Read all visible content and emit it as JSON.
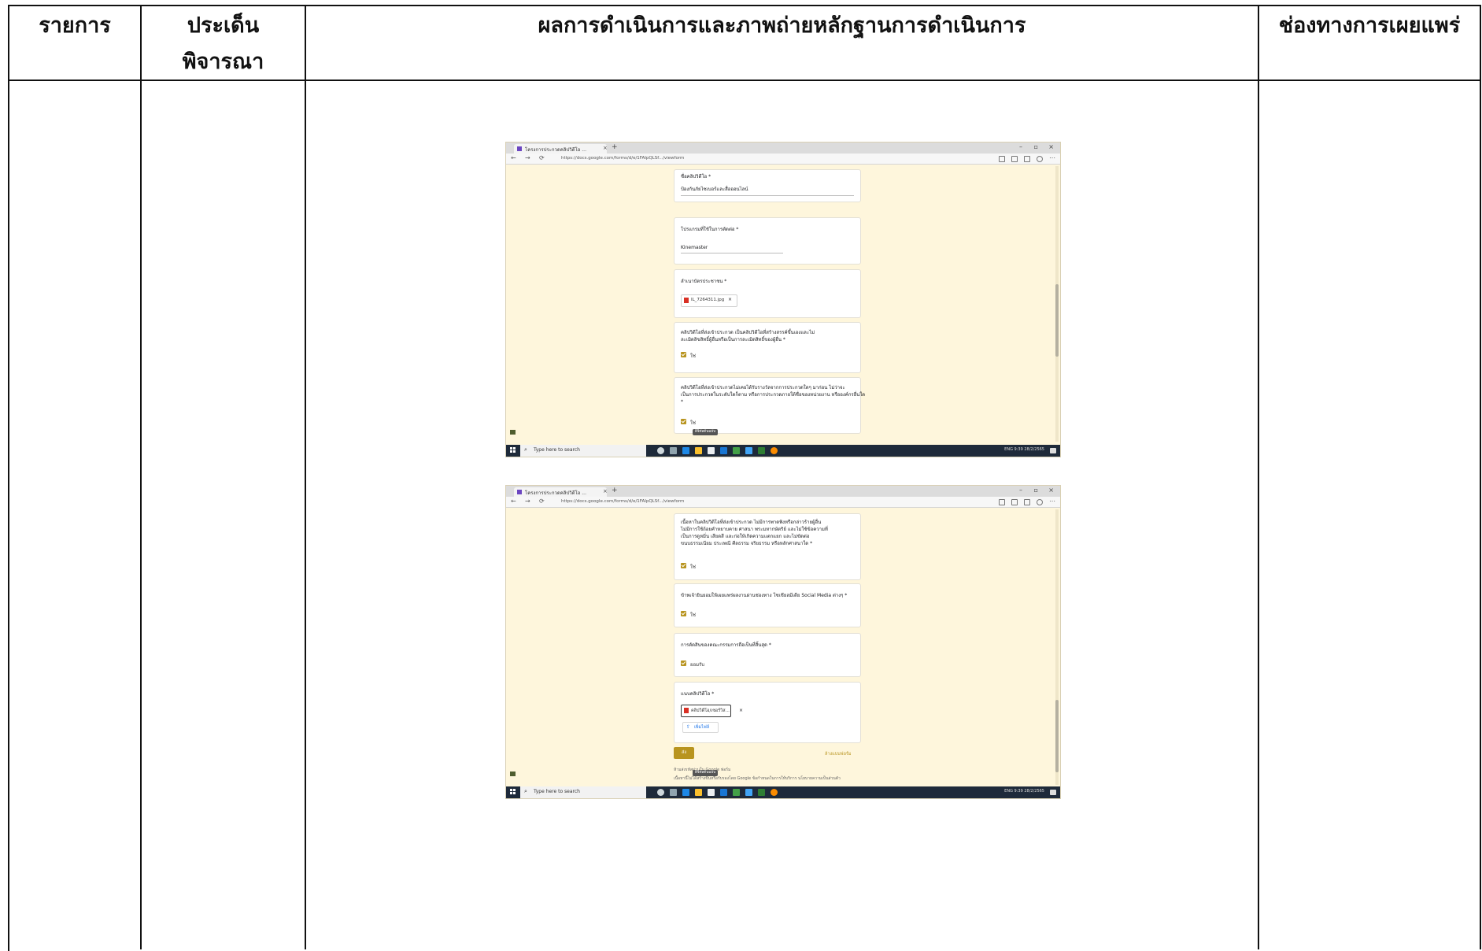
{
  "table": {
    "headers": {
      "col1": "รายการ",
      "col2_line1": "ประเด็น",
      "col2_line2": "พิจารณา",
      "col3": "ผลการดำเนินการและภาพถ่ายหลักฐานการดำเนินการ",
      "col4": "ช่องทางการเผยแพร่"
    }
  },
  "screenshot1": {
    "tab_title": "โครงการประกวดคลิปวิดีโอ ...",
    "url": "https://docs.google.com/forms/d/e/1FAIpQLSf.../viewform",
    "cards": [
      {
        "question": "ชื่อคลิปวิดีโอ *",
        "answer": "ป้องกันภัยไซเบอร์และสื่อออนไลน์"
      },
      {
        "question": "โปรแกรมที่ใช้ในการตัดต่อ *",
        "answer": "Kinemaster"
      },
      {
        "question": "ลำเนาบัตรประชาชน *",
        "file": "IL_7264311.jpg"
      },
      {
        "question_line1": "คลิปวิดีโอที่ส่งเข้าประกวด เป็นคลิปวิดีโอที่สร้างสรรค์ขึ้นเองและไม่",
        "question_line2": "ละเมิดลิขสิทธิ์ผู้อื่นหรือเป็นการละเมิดสิทธิ์ของผู้อื่น *",
        "check": "ใช่"
      },
      {
        "question_line1": "คลิปวิดีโอที่ส่งเข้าประกวดไม่เคยได้รับรางวัลจากการประกวดใดๆ มาก่อน ไม่ว่าจะ",
        "question_line2": "เป็นการประกวดในระดับใดก็ตาม หรือการประกวดภายใต้ชื่อของหน่วยงาน หรือองค์กรอื่นใด",
        "question_line3": "*",
        "check": "ใช่"
      }
    ],
    "tooltip": "ดิจิทัลต้นฉบับ",
    "search_placeholder": "Type here to search",
    "tray_text": "ENG 9:39 28/2/2565"
  },
  "screenshot2": {
    "tab_title": "โครงการประกวดคลิปวิดีโอ ...",
    "url": "https://docs.google.com/forms/d/e/1FAIpQLSf.../viewform",
    "cards": [
      {
        "question_line1": "เนื้อหาในคลิปวิดีโอที่ส่งเข้าประกวด ไม่มีการพาดพิงหรือกล่าวร้ายผู้อื่น",
        "question_line2": "ไม่มีการใช้ถ้อยคำหยาบคาย ศาสนา พระมหากษัตริย์ และไม่ใช้ข้อความที่",
        "question_line3": "เป็นการดูหมิ่น เสียดสี และก่อให้เกิดความแตกแยก และไม่ขัดต่อ",
        "question_line4": "ขนบธรรมเนียม ประเพณี ศีลธรรม จริยธรรม หรือหลักศาสนาใด *",
        "check": "ใช่"
      },
      {
        "question": "ข้าพเจ้ายินยอมให้เผยแพร่ผลงานผ่านช่องทาง โซเชียลมีเดีย Social Media ต่างๆ *",
        "check": "ใช่"
      },
      {
        "question": "การตัดสินของคณะกรรมการถือเป็นที่สิ้นสุด *",
        "check": "ยอมรับ"
      },
      {
        "question": "แนบคลิปวิดีโอ *",
        "file": "คลิปวิดีโอ/เซอร์วิส...",
        "add_file": "เพิ่มไฟล์"
      }
    ],
    "submit": "ส่ง",
    "clear": "ล้างแบบฟอร์ม",
    "footer_line1": "ห้ามส่งรหัสผ่านใน Google ฟอร์ม",
    "footer_line2": "เนื้อหานี้ไม่ได้สร้างขึ้นหรือรับรองโดย Google ข้อกำหนดในการให้บริการ นโยบายความเป็นส่วนตัว",
    "tooltip": "ดิจิทัลต้นฉบับ",
    "search_placeholder": "Type here to search",
    "tray_text": "ENG 9:39 28/2/2565"
  },
  "colors": {
    "form_background": "#fef6dc",
    "accent": "#b8941f",
    "taskbar": "#1e2a3a"
  }
}
